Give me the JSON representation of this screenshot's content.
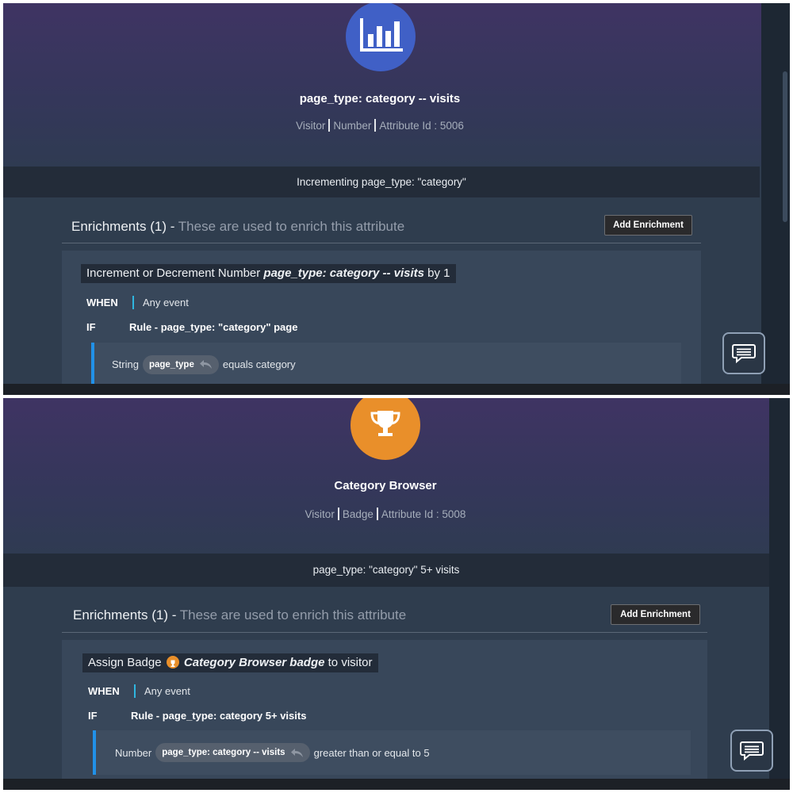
{
  "panels": [
    {
      "hero_icon": "bar-chart-icon",
      "accent_color": "#4060c6",
      "title": "page_type: category -- visits",
      "meta": [
        "Visitor",
        "Number",
        "Attribute Id : 5006"
      ],
      "description": "Incrementing page_type: \"category\"",
      "enrichments_title": "Enrichments (1) -",
      "enrichments_subtitle": "These are used to enrich this attribute",
      "add_button": "Add Enrichment",
      "card": {
        "action_prefix": "Increment or Decrement Number",
        "action_target": "page_type: category -- visits",
        "action_suffix": "by 1",
        "when_label": "WHEN",
        "when_value": "Any event",
        "if_label": "IF",
        "rule": "Rule - page_type: \"category\" page",
        "condition_type": "String",
        "condition_pill": "page_type",
        "condition_text": "equals category"
      }
    },
    {
      "hero_icon": "trophy-icon",
      "accent_color": "#e98f2a",
      "title": "Category Browser",
      "meta": [
        "Visitor",
        "Badge",
        "Attribute Id : 5008"
      ],
      "description": "page_type: \"category\" 5+ visits",
      "enrichments_title": "Enrichments (1) -",
      "enrichments_subtitle": "These are used to enrich this attribute",
      "add_button": "Add Enrichment",
      "card": {
        "action_prefix": "Assign Badge",
        "action_target": "Category Browser badge",
        "action_suffix": "to visitor",
        "when_label": "WHEN",
        "when_value": "Any event",
        "if_label": "IF",
        "rule": "Rule - page_type: category 5+ visits",
        "condition_type": "Number",
        "condition_pill": "page_type: category -- visits",
        "condition_text": "greater than or equal to 5"
      }
    }
  ]
}
